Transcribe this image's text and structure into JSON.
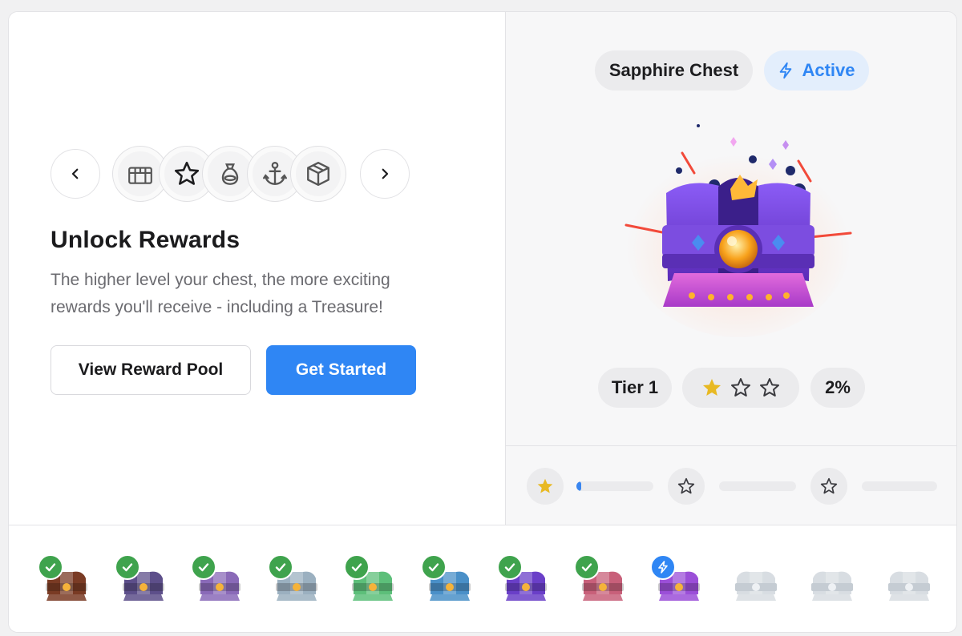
{
  "carousel": {
    "prev_icon": "chevron-left-icon",
    "next_icon": "chevron-right-icon",
    "chests": [
      {
        "icon": "treasure-chest-icon",
        "selected": false
      },
      {
        "icon": "star-icon",
        "selected": true
      },
      {
        "icon": "money-bag-icon",
        "selected": false
      },
      {
        "icon": "anchor-icon",
        "selected": false
      },
      {
        "icon": "box-icon",
        "selected": false
      }
    ]
  },
  "intro": {
    "title": "Unlock Rewards",
    "description": "The higher level your chest, the more exciting rewards you'll receive - including a Treasure!"
  },
  "actions": {
    "view_pool_label": "View Reward Pool",
    "get_started_label": "Get Started"
  },
  "chest_info": {
    "name": "Sapphire Chest",
    "status": "Active",
    "status_icon": "lightning-icon",
    "tier": "Tier 1",
    "stars_filled": 1,
    "stars_total": 3,
    "progress": "2%"
  },
  "milestones": {
    "segments": [
      {
        "star": "filled",
        "fill_fraction": 0.02
      },
      {
        "star": "empty",
        "fill_fraction": 0
      },
      {
        "star": "empty",
        "fill_fraction": 0
      }
    ]
  },
  "tiers": [
    {
      "status": "completed",
      "color": "#7a3b24"
    },
    {
      "status": "completed",
      "color": "#5d4f8a"
    },
    {
      "status": "completed",
      "color": "#8a6ab8"
    },
    {
      "status": "completed",
      "color": "#9bb0c0"
    },
    {
      "status": "completed",
      "color": "#5dbf7a"
    },
    {
      "status": "completed",
      "color": "#4a90c8"
    },
    {
      "status": "completed",
      "color": "#6a3fc8"
    },
    {
      "status": "completed",
      "color": "#c8607a"
    },
    {
      "status": "current",
      "color": "#9b4fd8"
    },
    {
      "status": "locked",
      "color": "#d8dde2"
    },
    {
      "status": "locked",
      "color": "#d8dde2"
    },
    {
      "status": "locked",
      "color": "#d8dde2"
    }
  ],
  "colors": {
    "accent": "#2f86f4",
    "success": "#3fa34d",
    "star_gold": "#e8b923"
  }
}
